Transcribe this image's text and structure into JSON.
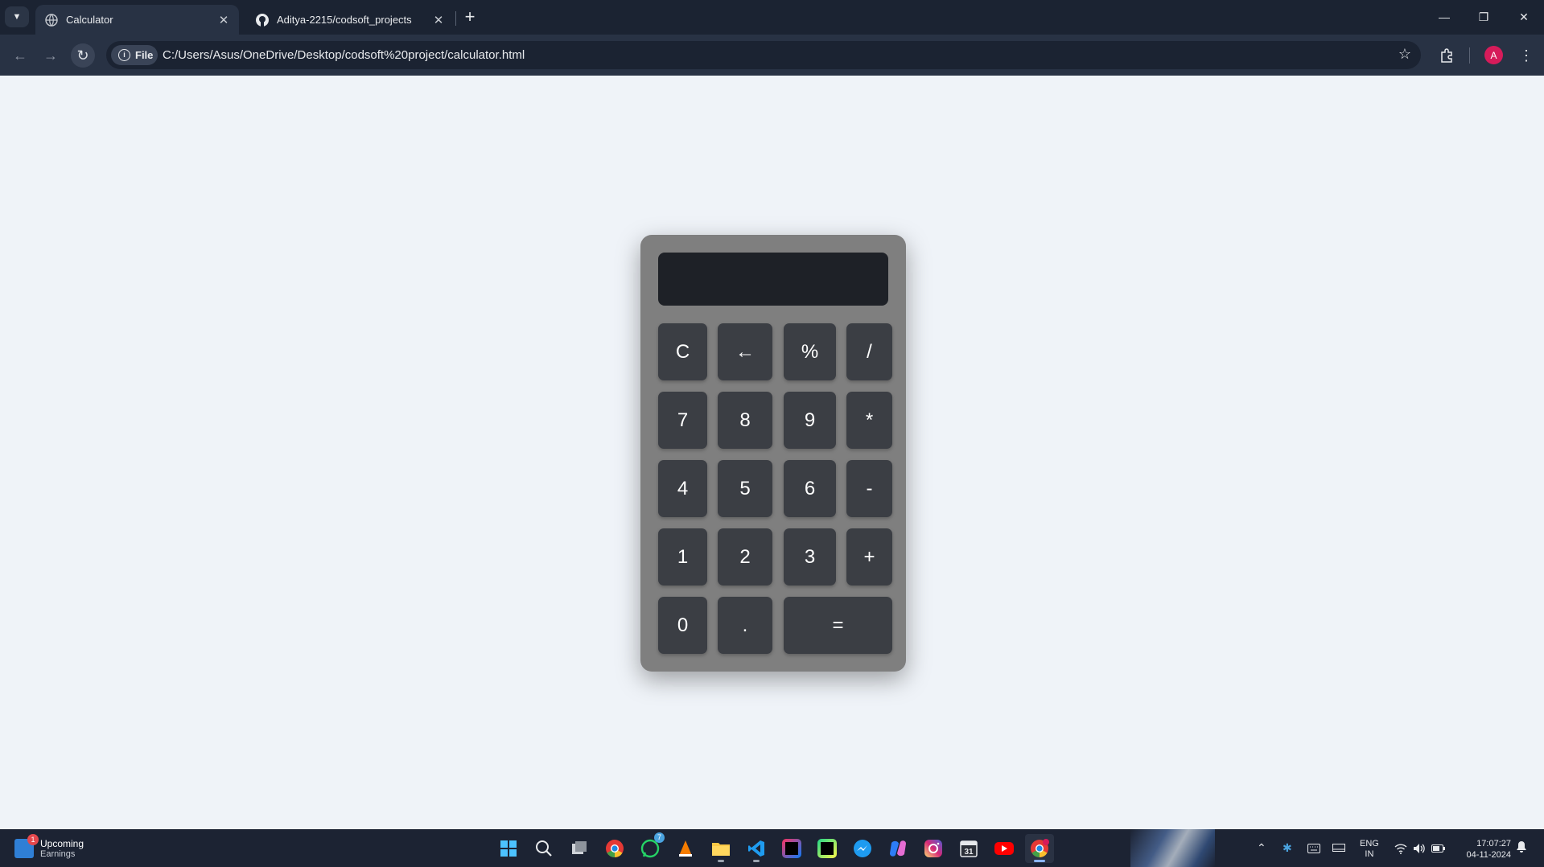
{
  "browser": {
    "tabs": [
      {
        "title": "Calculator",
        "active": true,
        "icon": "globe-icon"
      },
      {
        "title": "Aditya-2215/codsoft_projects",
        "active": false,
        "icon": "github-icon"
      }
    ],
    "url_chip": "File",
    "url": "C:/Users/Asus/OneDrive/Desktop/codsoft%20project/calculator.html",
    "profile_initial": "A",
    "accent": "#d61b5a"
  },
  "calculator": {
    "display_value": "",
    "rows": [
      [
        "C",
        "←",
        "%",
        "/"
      ],
      [
        "7",
        "8",
        "9",
        "*"
      ],
      [
        "4",
        "5",
        "6",
        "-"
      ],
      [
        "1",
        "2",
        "3",
        "+"
      ],
      [
        "0",
        ".",
        "="
      ]
    ],
    "colors": {
      "body": "#7f7f7f",
      "display": "#1e2127",
      "key": "#3b3e44",
      "page": "#eff3f8"
    }
  },
  "taskbar": {
    "widget": {
      "badge": "1",
      "line1": "Upcoming",
      "line2": "Earnings"
    },
    "apps": [
      {
        "name": "start-icon"
      },
      {
        "name": "search-icon"
      },
      {
        "name": "task-view-icon"
      },
      {
        "name": "chrome-icon"
      },
      {
        "name": "whatsapp-icon",
        "badge": "7"
      },
      {
        "name": "vlc-icon"
      },
      {
        "name": "file-explorer-icon"
      },
      {
        "name": "vscode-icon"
      },
      {
        "name": "intellij-icon"
      },
      {
        "name": "pycharm-icon"
      },
      {
        "name": "messenger-icon"
      },
      {
        "name": "copilot-icon"
      },
      {
        "name": "instagram-icon"
      },
      {
        "name": "calendar-icon"
      },
      {
        "name": "youtube-icon"
      },
      {
        "name": "chrome-profile-icon",
        "active": true
      }
    ],
    "lang_line1": "ENG",
    "lang_line2": "IN",
    "time": "17:07:27",
    "date": "04-11-2024"
  }
}
